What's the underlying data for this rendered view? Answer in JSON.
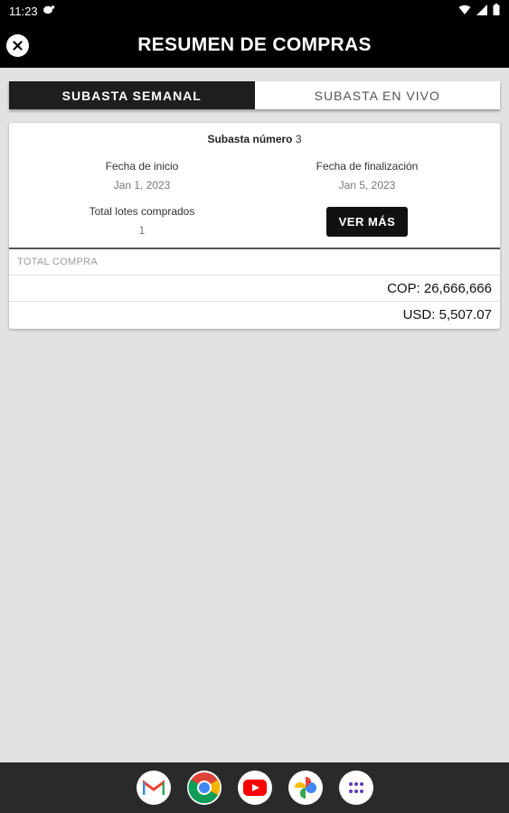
{
  "status": {
    "time": "11:23"
  },
  "header": {
    "title": "RESUMEN DE COMPRAS"
  },
  "tabs": [
    {
      "label": "SUBASTA SEMANAL",
      "active": true
    },
    {
      "label": "SUBASTA EN VIVO",
      "active": false
    }
  ],
  "auction": {
    "title_label": "Subasta número",
    "number": "3",
    "start_label": "Fecha de inicio",
    "start_value": "Jan 1, 2023",
    "end_label": "Fecha de finalización",
    "end_value": "Jan 5, 2023",
    "lots_label": "Total lotes comprados",
    "lots_value": "1",
    "more_button": "VER MÁS"
  },
  "totals": {
    "label": "TOTAL COMPRA",
    "cop": "COP: 26,666,666",
    "usd": "USD: 5,507.07"
  },
  "dock": {
    "apps": [
      "gmail-icon",
      "chrome-icon",
      "youtube-icon",
      "photos-icon",
      "app-drawer-icon"
    ]
  },
  "colors": {
    "app_bar": "#000000",
    "tab_active": "#1e1e1e",
    "background": "#e2e2e2",
    "button": "#111111"
  }
}
